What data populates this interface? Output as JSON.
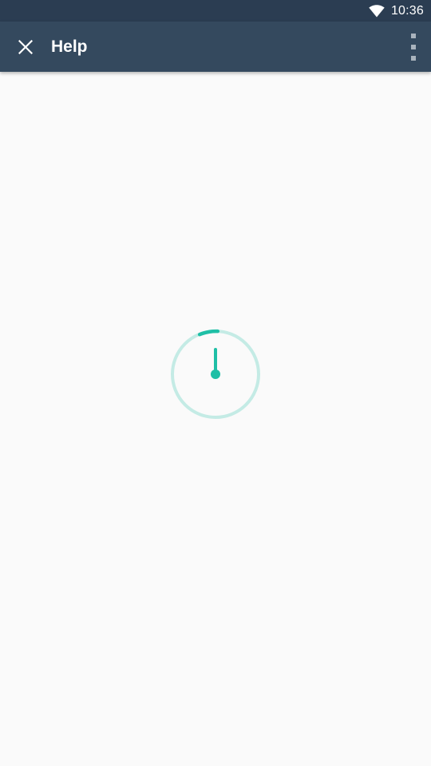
{
  "status_bar": {
    "time": "10:36",
    "wifi_icon": "wifi-full-icon"
  },
  "toolbar": {
    "title": "Help",
    "close_icon": "close-icon",
    "overflow_icon": "more-vert-icon",
    "background_color": "#34495e"
  },
  "status_bar_color": "#2b3d52",
  "content": {
    "loading_indicator": "stopwatch-loading-icon",
    "accent_color": "#1fbfa6",
    "accent_light_color": "#c4ebe5"
  }
}
